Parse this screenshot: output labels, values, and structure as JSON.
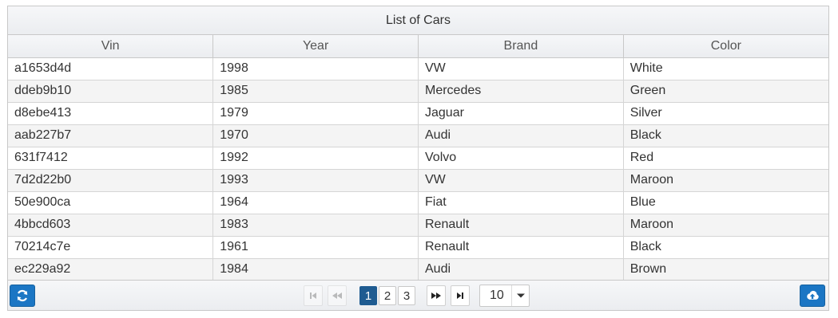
{
  "table": {
    "caption": "List of Cars",
    "columns": [
      "Vin",
      "Year",
      "Brand",
      "Color"
    ],
    "rows": [
      [
        "a1653d4d",
        "1998",
        "VW",
        "White"
      ],
      [
        "ddeb9b10",
        "1985",
        "Mercedes",
        "Green"
      ],
      [
        "d8ebe413",
        "1979",
        "Jaguar",
        "Silver"
      ],
      [
        "aab227b7",
        "1970",
        "Audi",
        "Black"
      ],
      [
        "631f7412",
        "1992",
        "Volvo",
        "Red"
      ],
      [
        "7d2d22b0",
        "1993",
        "VW",
        "Maroon"
      ],
      [
        "50e900ca",
        "1964",
        "Fiat",
        "Blue"
      ],
      [
        "4bbcd603",
        "1983",
        "Renault",
        "Maroon"
      ],
      [
        "70214c7e",
        "1961",
        "Renault",
        "Black"
      ],
      [
        "ec229a92",
        "1984",
        "Audi",
        "Brown"
      ]
    ]
  },
  "paginator": {
    "pages": [
      "1",
      "2",
      "3"
    ],
    "current_page": "1",
    "rows_per_page": "10",
    "refresh_icon": "refresh-icon",
    "export_icon": "cloud-upload-icon"
  },
  "colors": {
    "accent": "#1b76c4",
    "active_page": "#1e5b91"
  }
}
